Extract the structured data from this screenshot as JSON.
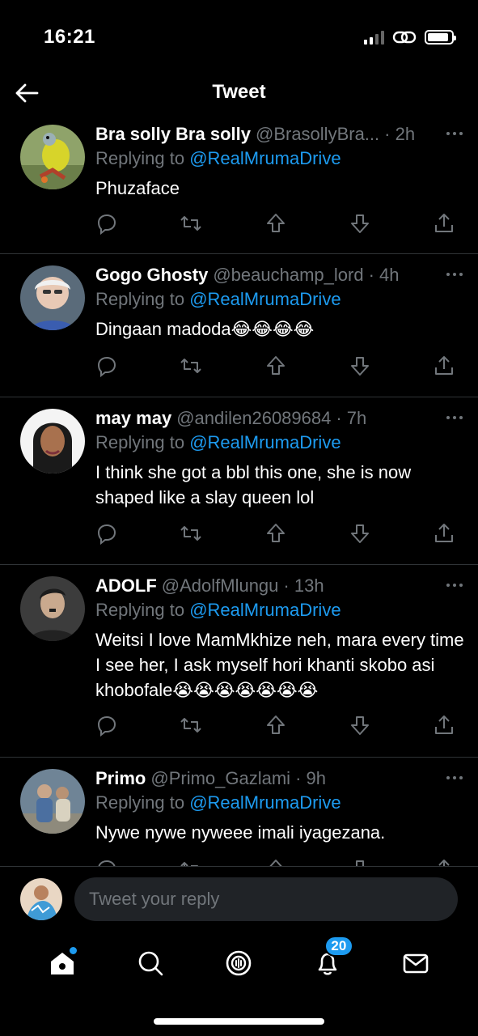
{
  "status_bar": {
    "time": "16:21"
  },
  "header": {
    "title": "Tweet"
  },
  "tweets": [
    {
      "name": "Bra solly Bra solly",
      "handle": "@BrasollyBra...",
      "time": "· 2h",
      "replying_prefix": "Replying to ",
      "mention": "@RealMrumaDrive",
      "text": "Phuzaface"
    },
    {
      "name": "Gogo Ghosty",
      "handle": "@beauchamp_lord",
      "time": "· 4h",
      "replying_prefix": "Replying to ",
      "mention": "@RealMrumaDrive",
      "text": "Dingaan madoda😂😂😂😂"
    },
    {
      "name": "may may",
      "handle": "@andilen26089684",
      "time": "· 7h",
      "replying_prefix": "Replying to ",
      "mention": "@RealMrumaDrive",
      "text": "I think she got a bbl this one, she is now shaped like a slay queen lol"
    },
    {
      "name": "ADOLF",
      "handle": "@AdolfMlungu",
      "time": "· 13h",
      "replying_prefix": "Replying to ",
      "mention": "@RealMrumaDrive",
      "text": "Weitsi I love MamMkhize neh, mara every time I see her, I ask myself hori khanti skobo asi khobofale😭😭😭😭😭😭😭"
    },
    {
      "name": "Primo",
      "handle": "@Primo_Gazlami",
      "time": "· 9h",
      "replying_prefix": "Replying to ",
      "mention": "@RealMrumaDrive",
      "text": "Nywe nywe nyweee imali iyagezana."
    }
  ],
  "reply_bar": {
    "placeholder": "Tweet your reply"
  },
  "tab_bar": {
    "notifications_count": "20"
  },
  "colors": {
    "accent": "#1d9bf0",
    "muted": "#71767b",
    "divider": "#2f3336"
  }
}
